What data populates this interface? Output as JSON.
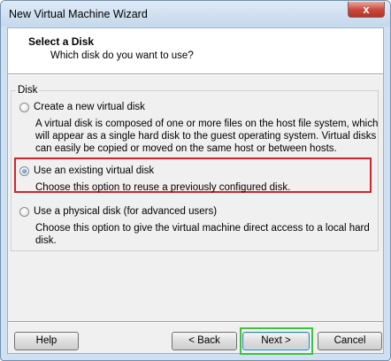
{
  "window": {
    "title": "New Virtual Machine Wizard",
    "close_glyph": "x"
  },
  "header": {
    "title": "Select a Disk",
    "subtitle": "Which disk do you want to use?"
  },
  "group": {
    "label": "Disk"
  },
  "options": [
    {
      "label": "Create a new virtual disk",
      "checked": false,
      "description_lines": [
        "A virtual disk is composed of one or more files on the host file system, which",
        "will appear as a single hard disk to the guest operating system. Virtual disks",
        "can easily be copied or moved on the same host or between hosts."
      ]
    },
    {
      "label": "Use an existing virtual disk",
      "checked": true,
      "description_lines": [
        "Choose this option to reuse a previously configured disk."
      ]
    },
    {
      "label": "Use a physical disk (for advanced users)",
      "checked": false,
      "description_lines": [
        "Choose this option to give the virtual machine direct access to a local hard",
        "disk."
      ]
    }
  ],
  "buttons": {
    "help": "Help",
    "back": "< Back",
    "next": "Next >",
    "cancel": "Cancel"
  },
  "colors": {
    "highlight_selected": "#d4242a",
    "highlight_next": "#3ec23e"
  }
}
